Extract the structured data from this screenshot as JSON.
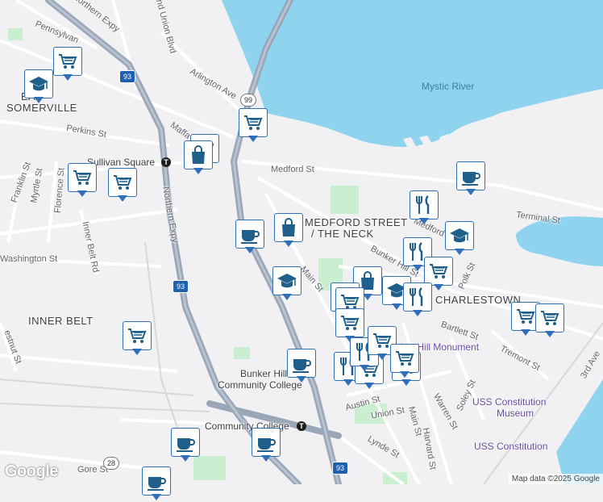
{
  "map": {
    "labels": {
      "mystic_river": "Mystic River",
      "east_somerville_1": "EAST",
      "east_somerville_2": "SOMERVILLE",
      "inner_belt": "INNER BELT",
      "medford_neck_1": "MEDFORD STREET",
      "medford_neck_2": "/ THE NECK",
      "charlestown": "CHARLESTOWN",
      "sullivan_square": "Sullivan Square",
      "bunker_hill_cc_1": "Bunker Hill",
      "bunker_hill_cc_2": "Community College",
      "community_college_station": "Community College",
      "bunker_hill_monument": "Bunker Hill Monument",
      "uss_museum_1": "USS Constitution",
      "uss_museum_2": "Museum",
      "uss_constitution": "USS Constitution",
      "northern_expy_top": "Northern Expy",
      "northern_expy_side": "Northern Expy",
      "grand_union_blvd": "Grand Union Blvd",
      "pennsylvania_ave": "Pennsylvan",
      "arlington_ave": "Arlington Ave",
      "perkins_st": "Perkins St",
      "medford_st": "Medford St",
      "medford_st_2": "Medford",
      "terminal_st": "Terminal St",
      "franklin_st": "Franklin St",
      "myrtle_st": "Myrtle St",
      "florence_st": "Florence St",
      "inner_belt_rd": "Inner Belt Rd",
      "washington_st": "Washington St",
      "main_st": "Main St",
      "bunker_hill_st": "Bunker Hill St",
      "polk_st": "Polk St",
      "bartlett_st": "Bartlett St",
      "tremont_st": "Tremont St",
      "austin_st": "Austin St",
      "union_st": "Union St",
      "warren_st": "Warren St",
      "soley_st": "Soley St",
      "main_st_2": "Main St",
      "harvard_st": "Harvard St",
      "lynde_st": "Lynde St",
      "gore_st": "Gore St",
      "restnut_st": "estnut St",
      "third_ave": "3rd Ave",
      "maffa": "Maffa",
      "hill": "Hill",
      "ea": "EA"
    },
    "shields": {
      "i93_a": "93",
      "i93_b": "93",
      "i93_c": "93",
      "rt99": "99",
      "rt28": "28"
    },
    "markers": [
      {
        "icon": "grocery",
        "name": "grocery-marker"
      },
      {
        "icon": "school",
        "name": "school-marker"
      },
      {
        "icon": "grocery",
        "name": "grocery-marker"
      },
      {
        "icon": "shopping",
        "name": "shopping-marker"
      },
      {
        "icon": "grocery",
        "name": "grocery-marker"
      },
      {
        "icon": "grocery",
        "name": "grocery-marker"
      },
      {
        "icon": "grocery",
        "name": "grocery-marker"
      },
      {
        "icon": "cafe",
        "name": "cafe-marker"
      },
      {
        "icon": "shopping",
        "name": "shopping-marker"
      },
      {
        "icon": "school",
        "name": "school-marker"
      },
      {
        "icon": "grocery",
        "name": "grocery-marker"
      },
      {
        "icon": "cafe",
        "name": "cafe-marker"
      },
      {
        "icon": "cafe",
        "name": "cafe-marker"
      },
      {
        "icon": "cafe",
        "name": "cafe-marker"
      },
      {
        "icon": "cafe",
        "name": "cafe-marker"
      },
      {
        "icon": "restaurant",
        "name": "restaurant-marker"
      },
      {
        "icon": "school",
        "name": "school-marker"
      },
      {
        "icon": "restaurant",
        "name": "restaurant-marker"
      },
      {
        "icon": "grocery",
        "name": "grocery-marker"
      },
      {
        "icon": "restaurant",
        "name": "restaurant-marker"
      },
      {
        "icon": "school",
        "name": "school-marker"
      },
      {
        "icon": "grocery",
        "name": "grocery-marker"
      },
      {
        "icon": "shopping",
        "name": "shopping-marker"
      },
      {
        "icon": "grocery",
        "name": "grocery-marker"
      },
      {
        "icon": "school",
        "name": "school-marker"
      },
      {
        "icon": "cafe",
        "name": "cafe-marker"
      },
      {
        "icon": "grocery",
        "name": "grocery-marker"
      },
      {
        "icon": "grocery",
        "name": "grocery-marker"
      },
      {
        "icon": "restaurant",
        "name": "restaurant-marker"
      },
      {
        "icon": "grocery",
        "name": "grocery-marker"
      },
      {
        "icon": "grocery",
        "name": "grocery-marker"
      },
      {
        "icon": "restaurant",
        "name": "restaurant-marker"
      },
      {
        "icon": "grocery",
        "name": "grocery-marker"
      },
      {
        "icon": "grocery",
        "name": "grocery-marker"
      }
    ],
    "colors": {
      "water": "#8fd3ef",
      "land": "#f1f1f4",
      "park": "#c9efd0",
      "highway": "#9aa7b8",
      "marker_border": "#2f6fb8",
      "marker_icon": "#1f5f8a"
    }
  },
  "attribution": {
    "logo": "Google",
    "text": "Map data ©2025 Google"
  }
}
